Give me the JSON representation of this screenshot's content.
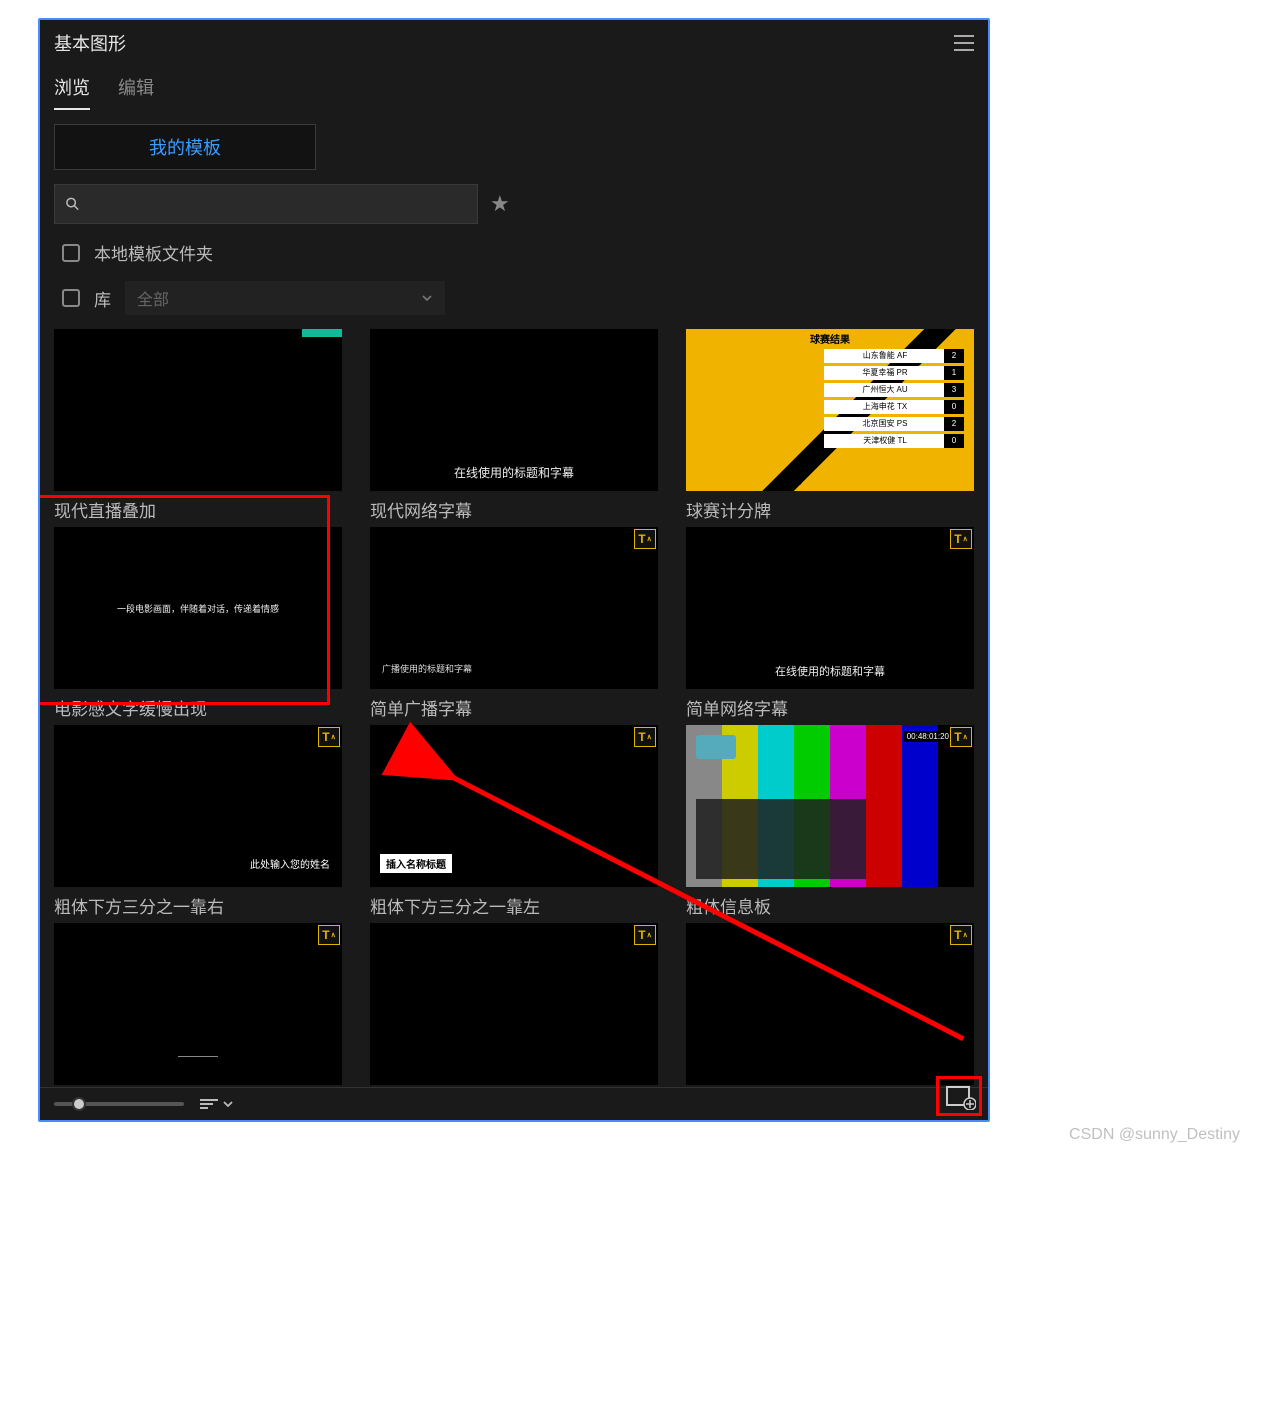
{
  "panel": {
    "title": "基本图形",
    "tabs": {
      "browse": "浏览",
      "edit": "编辑"
    },
    "my_templates_label": "我的模板",
    "search_placeholder": "",
    "filters": {
      "local_folder": "本地模板文件夹",
      "library": "库",
      "library_select": "全部"
    }
  },
  "templates": [
    {
      "label": "现代直播叠加",
      "badge": false,
      "preview_text": ""
    },
    {
      "label": "现代网络字幕",
      "badge": false,
      "preview_text": "在线使用的标题和字幕"
    },
    {
      "label": "球赛计分牌",
      "badge": false,
      "preview_text": "球赛结果",
      "scoreboard": [
        {
          "name": "山东鲁能 AF",
          "score": "2"
        },
        {
          "name": "华夏幸福 PR",
          "score": "1"
        },
        {
          "name": "广州恒大 AU",
          "score": "3"
        },
        {
          "name": "上海申花 TX",
          "score": "0"
        },
        {
          "name": "北京国安 PS",
          "score": "2"
        },
        {
          "name": "天津权健 TL",
          "score": "0"
        }
      ]
    },
    {
      "label": "电影感文字缓慢出现",
      "badge": false,
      "preview_text": "一段电影画面，伴随着对话，传递着情感"
    },
    {
      "label": "简单广播字幕",
      "badge": true,
      "preview_text": "广播使用的标题和字幕"
    },
    {
      "label": "简单网络字幕",
      "badge": true,
      "preview_text": "在线使用的标题和字幕"
    },
    {
      "label": "粗体下方三分之一靠右",
      "badge": true,
      "preview_text": "此处输入您的姓名"
    },
    {
      "label": "粗体下方三分之一靠左",
      "badge": true,
      "preview_text": "插入名称标题"
    },
    {
      "label": "粗体信息板",
      "badge": true,
      "preview_text": "",
      "timecode": "00:48:01:20"
    },
    {
      "label": "",
      "badge": true,
      "preview_text": ""
    },
    {
      "label": "",
      "badge": true,
      "preview_text": ""
    },
    {
      "label": "",
      "badge": true,
      "preview_text": ""
    }
  ],
  "watermark": "CSDN @sunny_Destiny",
  "annotations": {
    "highlight_template_index": 3,
    "arrow_from": "center-right",
    "arrow_to": "add-button"
  }
}
